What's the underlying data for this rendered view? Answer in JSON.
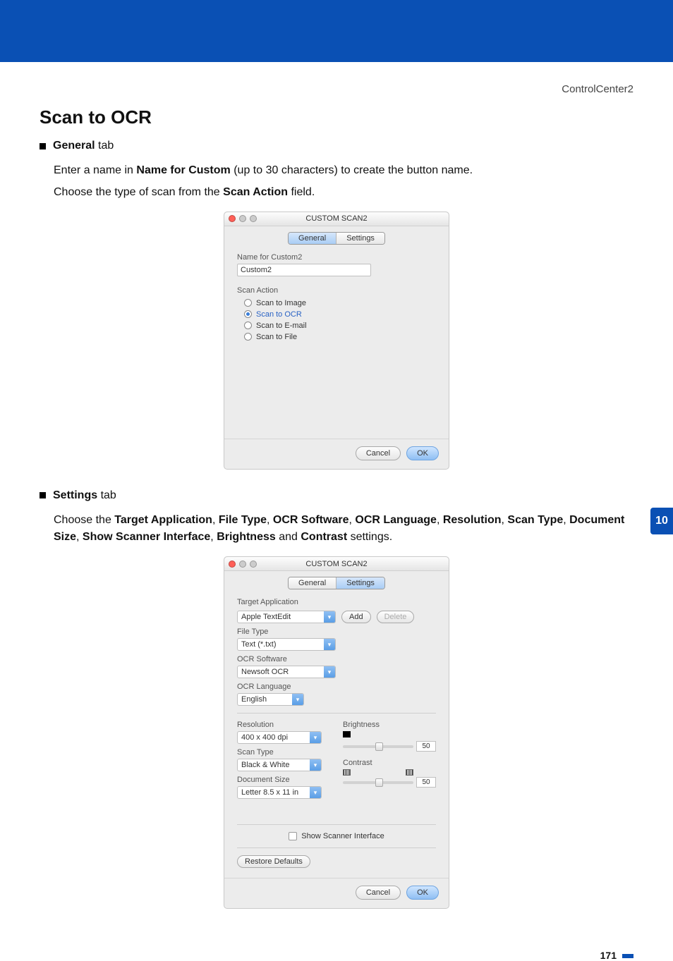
{
  "header": {
    "section_label": "ControlCenter2"
  },
  "section_title": "Scan to OCR",
  "bulletA": {
    "strong": "General",
    "suffix": " tab"
  },
  "para1": {
    "pre": "Enter a name in ",
    "strong": "Name for Custom",
    "post": " (up to 30 characters) to create the button name."
  },
  "para2": {
    "pre": "Choose the type of scan from the ",
    "strong": "Scan Action",
    "post": " field."
  },
  "dlg1": {
    "title": "CUSTOM SCAN2",
    "tab_general": "General",
    "tab_settings": "Settings",
    "name_label": "Name for Custom2",
    "name_value": "Custom2",
    "scan_action_label": "Scan Action",
    "opt_image": "Scan to Image",
    "opt_ocr": "Scan to OCR",
    "opt_email": "Scan to E-mail",
    "opt_file": "Scan to File",
    "cancel": "Cancel",
    "ok": "OK"
  },
  "bulletB": {
    "strong": "Settings",
    "suffix": " tab"
  },
  "para3": {
    "pre": "Choose the ",
    "b1": "Target Application",
    "c1": ", ",
    "b2": "File Type",
    "c2": ", ",
    "b3": "OCR Software",
    "c3": ", ",
    "b4": "OCR Language",
    "c4": ", ",
    "b5": "Resolution",
    "c5": ", ",
    "b6": "Scan Type",
    "c6": ", ",
    "b7": "Document Size",
    "c7": ", ",
    "b8": "Show Scanner Interface",
    "c8": ", ",
    "b9": "Brightness",
    "c9": " and ",
    "b10": "Contrast",
    "post": " settings."
  },
  "dlg2": {
    "title": "CUSTOM SCAN2",
    "tab_general": "General",
    "tab_settings": "Settings",
    "target_label": "Target Application",
    "target_value": "Apple TextEdit",
    "add": "Add",
    "delete": "Delete",
    "file_type_label": "File Type",
    "file_type_value": "Text (*.txt)",
    "ocr_sw_label": "OCR Software",
    "ocr_sw_value": "Newsoft OCR",
    "ocr_lang_label": "OCR Language",
    "ocr_lang_value": "English",
    "resolution_label": "Resolution",
    "resolution_value": "400 x 400 dpi",
    "scan_type_label": "Scan Type",
    "scan_type_value": "Black & White",
    "doc_size_label": "Document Size",
    "doc_size_value": "Letter  8.5 x 11 in",
    "brightness_label": "Brightness",
    "brightness_value": "50",
    "contrast_label": "Contrast",
    "contrast_value": "50",
    "show_scanner": "Show Scanner Interface",
    "restore": "Restore Defaults",
    "cancel": "Cancel",
    "ok": "OK"
  },
  "sidebar_chapter": "10",
  "page_number": "171"
}
